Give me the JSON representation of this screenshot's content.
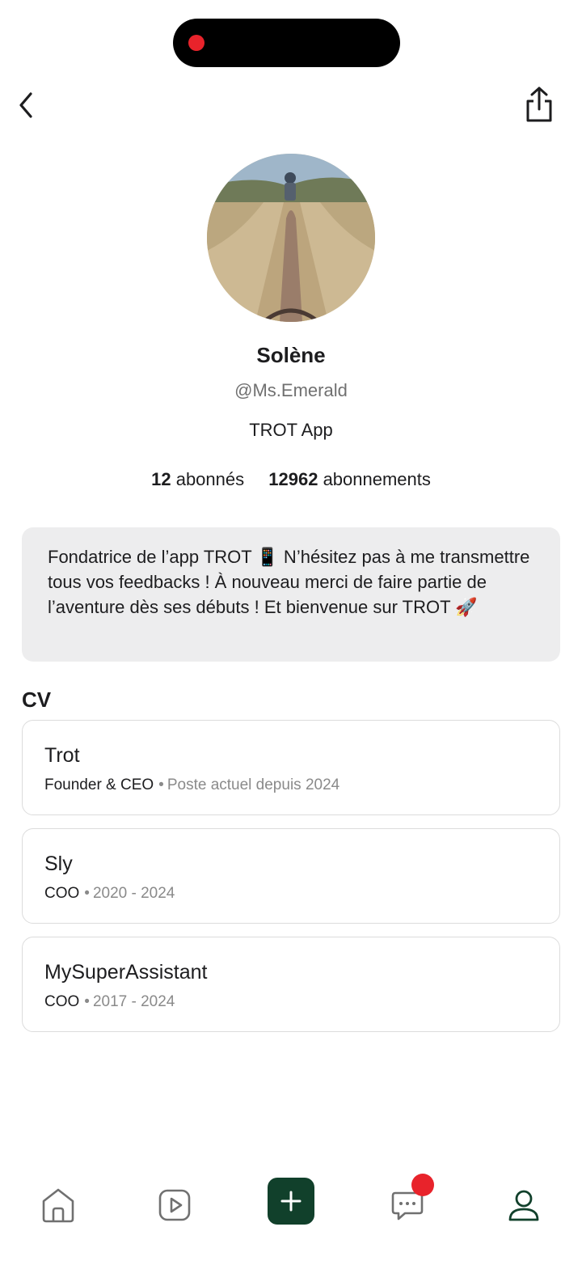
{
  "header": {
    "back_icon": "chevron-left-icon",
    "share_icon": "share-icon"
  },
  "profile": {
    "name": "Solène",
    "handle": "@Ms.Emerald",
    "company": "TROT App",
    "followers_count": "12",
    "followers_label": "abonnés",
    "following_count": "12962",
    "following_label": "abonnements",
    "bio": "Fondatrice de l’app TROT 📱 N’hésitez pas à me transmettre tous vos feedbacks ! À nouveau merci de faire partie de l’aventure dès ses débuts ! Et bienvenue sur TROT 🚀"
  },
  "cv": {
    "title": "CV",
    "entries": [
      {
        "company": "Trot",
        "role": "Founder & CEO",
        "period": "Poste actuel depuis 2024"
      },
      {
        "company": "Sly",
        "role": "COO",
        "period": "2020 - 2024"
      },
      {
        "company": "MySuperAssistant",
        "role": "COO",
        "period": "2017 - 2024"
      }
    ],
    "separator": "•"
  },
  "tabbar": {
    "items": [
      "home-icon",
      "video-icon",
      "add-icon",
      "messages-icon",
      "profile-icon"
    ],
    "accent": "#11402b",
    "badge_color": "#e8232b"
  }
}
